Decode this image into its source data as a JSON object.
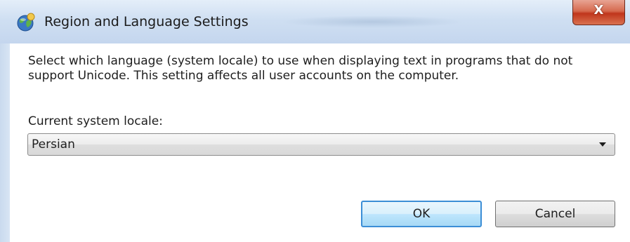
{
  "window": {
    "title": "Region and Language Settings",
    "close_glyph": "X",
    "title_icon": "globe-icon"
  },
  "dialog": {
    "description": "Select which language (system locale) to use when displaying text in programs that do not support Unicode. This setting affects all user accounts on the computer.",
    "locale_label": "Current system locale:",
    "locale_selected": "Persian"
  },
  "buttons": {
    "ok_label": "OK",
    "cancel_label": "Cancel"
  },
  "colors": {
    "titlebar": "#cfdff2",
    "close_button": "#c0361c",
    "ok_border": "#3c8ed6"
  }
}
